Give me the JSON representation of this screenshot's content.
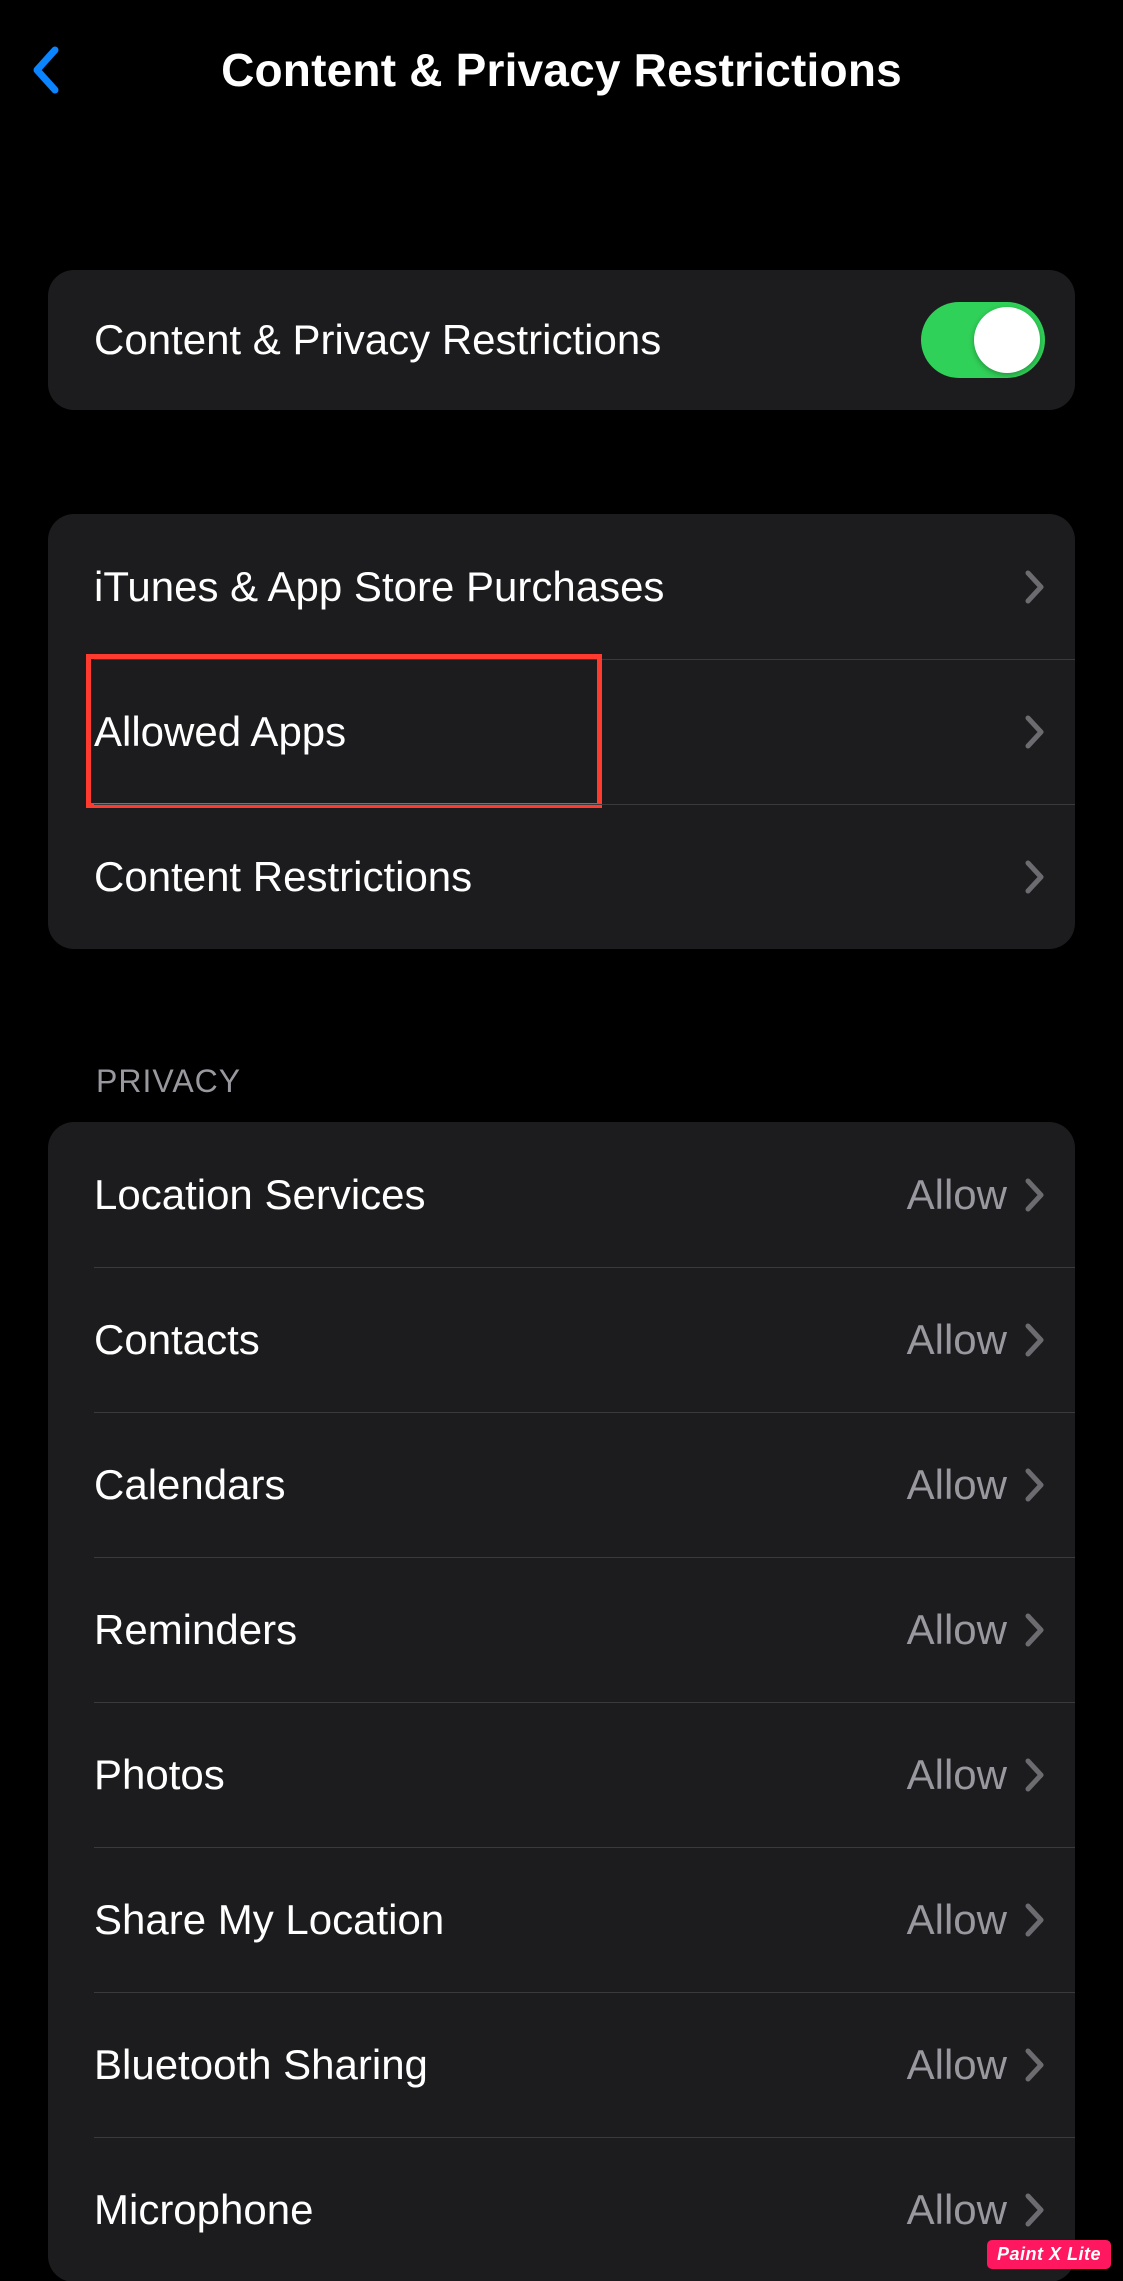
{
  "header": {
    "title": "Content & Privacy Restrictions"
  },
  "toggle_group": {
    "label": "Content & Privacy Restrictions",
    "on": true
  },
  "main_items": [
    {
      "label": "iTunes & App Store Purchases"
    },
    {
      "label": "Allowed Apps"
    },
    {
      "label": "Content Restrictions"
    }
  ],
  "privacy_header": "PRIVACY",
  "privacy_items": [
    {
      "label": "Location Services",
      "value": "Allow"
    },
    {
      "label": "Contacts",
      "value": "Allow"
    },
    {
      "label": "Calendars",
      "value": "Allow"
    },
    {
      "label": "Reminders",
      "value": "Allow"
    },
    {
      "label": "Photos",
      "value": "Allow"
    },
    {
      "label": "Share My Location",
      "value": "Allow"
    },
    {
      "label": "Bluetooth Sharing",
      "value": "Allow"
    },
    {
      "label": "Microphone",
      "value": "Allow"
    }
  ],
  "watermark": "Paint X Lite",
  "colors": {
    "accent": "#0a84ff",
    "toggle_on": "#30d158",
    "highlight": "#ff3b30"
  }
}
